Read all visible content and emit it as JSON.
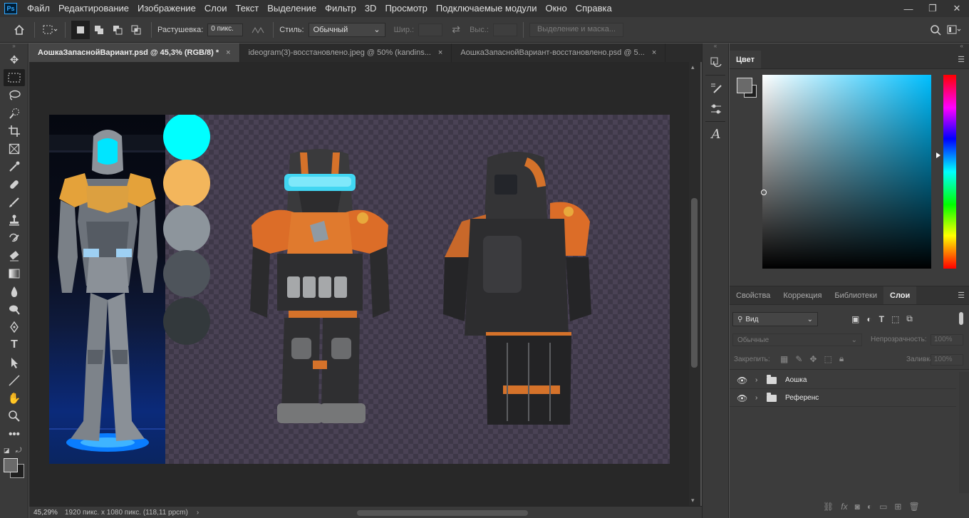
{
  "app": {
    "logo_text": "Ps"
  },
  "menu": {
    "items": [
      "Файл",
      "Редактирование",
      "Изображение",
      "Слои",
      "Текст",
      "Выделение",
      "Фильтр",
      "3D",
      "Просмотр",
      "Подключаемые модули",
      "Окно",
      "Справка"
    ]
  },
  "window_controls": {
    "minimize": "—",
    "restore": "❐",
    "close": "✕"
  },
  "options_bar": {
    "feather_label": "Растушевка:",
    "feather_value": "0 пикс.",
    "style_label": "Стиль:",
    "style_value": "Обычный",
    "width_label": "Шир.:",
    "height_label": "Выс.:",
    "select_mask_label": "Выделение и маска..."
  },
  "tabs": [
    {
      "label": "АошкаЗапаснойВариант.psd @ 45,3% (RGB/8) *",
      "close": "×",
      "active": true
    },
    {
      "label": "ideogram(3)-восстановлено.jpeg @ 50% (kandins...",
      "close": "×",
      "active": false
    },
    {
      "label": "АошкаЗапаснойВариант-восстановлено.psd @ 5...",
      "close": "×",
      "active": false
    }
  ],
  "palette_swatches": [
    "#00ffff",
    "#f3b65c",
    "#8d959c",
    "#4e545b",
    "#33393c"
  ],
  "status_bar": {
    "zoom": "45,29%",
    "doc_info": "1920 пикс. x 1080 пикс. (118,11 ppcm)",
    "arrow": "›"
  },
  "color_panel": {
    "title": "Цвет",
    "foreground": "#6a6a6a",
    "background": "#1f1f1f"
  },
  "layers_panel": {
    "tabs": [
      {
        "label": "Свойства",
        "active": false
      },
      {
        "label": "Коррекция",
        "active": false
      },
      {
        "label": "Библиотеки",
        "active": false
      },
      {
        "label": "Слои",
        "active": true
      }
    ],
    "filter_label": "Вид",
    "blend_mode": "Обычные",
    "opacity_label": "Непрозрачность:",
    "opacity_value": "100%",
    "lock_label": "Закрепить:",
    "fill_label": "Заливка:",
    "fill_value": "100%",
    "layers": [
      {
        "name": "Аошка",
        "type": "group",
        "visible": true
      },
      {
        "name": "Референс",
        "type": "group",
        "visible": true
      }
    ]
  }
}
